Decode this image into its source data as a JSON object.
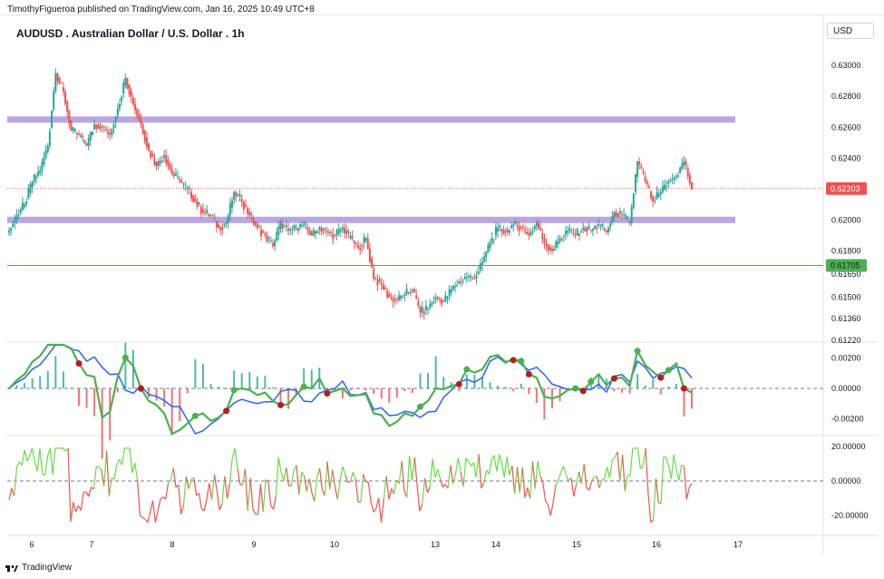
{
  "header": {
    "attribution": "TimothyFigueroa published on TradingView.com, Jan 16, 2025 10:49 UTC+8"
  },
  "symbol": {
    "title": "AUDUSD . Australian Dollar / U.S. Dollar . 1h",
    "currency": "USD"
  },
  "footer": {
    "brand": "TradingView",
    "logo_icon": "tradingview-logo-icon"
  },
  "colors": {
    "up": "#26a69a",
    "down": "#ef5350",
    "zone": "#b39ddb",
    "support_line": "#4caf50",
    "macd_fast": "#4caf50",
    "macd_fast_down": "#b71c1c",
    "macd_signal": "#2962ff",
    "hist_up": "#26a69a",
    "hist_down": "#ef5350",
    "osc_up": "#66dd44",
    "osc_down": "#ef5350",
    "last_price": "#ef5350"
  },
  "chart_data": [
    {
      "type": "candlestick",
      "title": "AUDUSD . Australian Dollar / U.S. Dollar . 1h",
      "x_ticks": [
        "6",
        "7",
        "8",
        "9",
        "10",
        "13",
        "14",
        "15",
        "16",
        "17"
      ],
      "y_ticks": [
        "0.63000",
        "0.62800",
        "0.62600",
        "0.62400",
        "0.62000",
        "0.61800",
        "0.61650",
        "0.61500",
        "0.61360",
        "0.61220"
      ],
      "ylim": [
        0.6122,
        0.6316
      ],
      "last_price": {
        "label": "0.62203",
        "value": 0.62203
      },
      "support_price": {
        "label": "0.61705",
        "value": 0.61705
      },
      "zones": [
        {
          "center": 0.6265
        },
        {
          "center": 0.62
        }
      ],
      "close_path": [
        0.6193,
        0.6203,
        0.621,
        0.6225,
        0.6232,
        0.6248,
        0.6295,
        0.6283,
        0.6258,
        0.6255,
        0.6248,
        0.6262,
        0.626,
        0.6255,
        0.6272,
        0.6292,
        0.6275,
        0.6262,
        0.6245,
        0.6235,
        0.6242,
        0.623,
        0.6225,
        0.622,
        0.6212,
        0.6205,
        0.6203,
        0.6195,
        0.6198,
        0.6218,
        0.6212,
        0.6203,
        0.6195,
        0.619,
        0.6183,
        0.6198,
        0.6193,
        0.6195,
        0.6197,
        0.619,
        0.6195,
        0.6192,
        0.619,
        0.6195,
        0.6188,
        0.6182,
        0.6188,
        0.6162,
        0.6158,
        0.615,
        0.6148,
        0.6152,
        0.6155,
        0.614,
        0.6143,
        0.615,
        0.6147,
        0.6155,
        0.616,
        0.6163,
        0.6162,
        0.6173,
        0.6185,
        0.6195,
        0.6192,
        0.6197,
        0.6195,
        0.619,
        0.6198,
        0.6185,
        0.618,
        0.6188,
        0.6193,
        0.619,
        0.6195,
        0.6193,
        0.6197,
        0.6192,
        0.6205,
        0.6203,
        0.6198,
        0.6238,
        0.6225,
        0.6212,
        0.6218,
        0.6225,
        0.6228,
        0.6238,
        0.622
      ]
    },
    {
      "type": "line",
      "title": "",
      "y_ticks": [
        "0.00200",
        "0.00000",
        "-0.00200"
      ],
      "ylim": [
        -0.0035,
        0.0027
      ],
      "zero_line": true
    },
    {
      "type": "line",
      "title": "",
      "y_ticks": [
        "20.00000",
        "0.00000",
        "-20.00000"
      ],
      "ylim": [
        -26,
        21
      ],
      "zero_line": true
    }
  ]
}
